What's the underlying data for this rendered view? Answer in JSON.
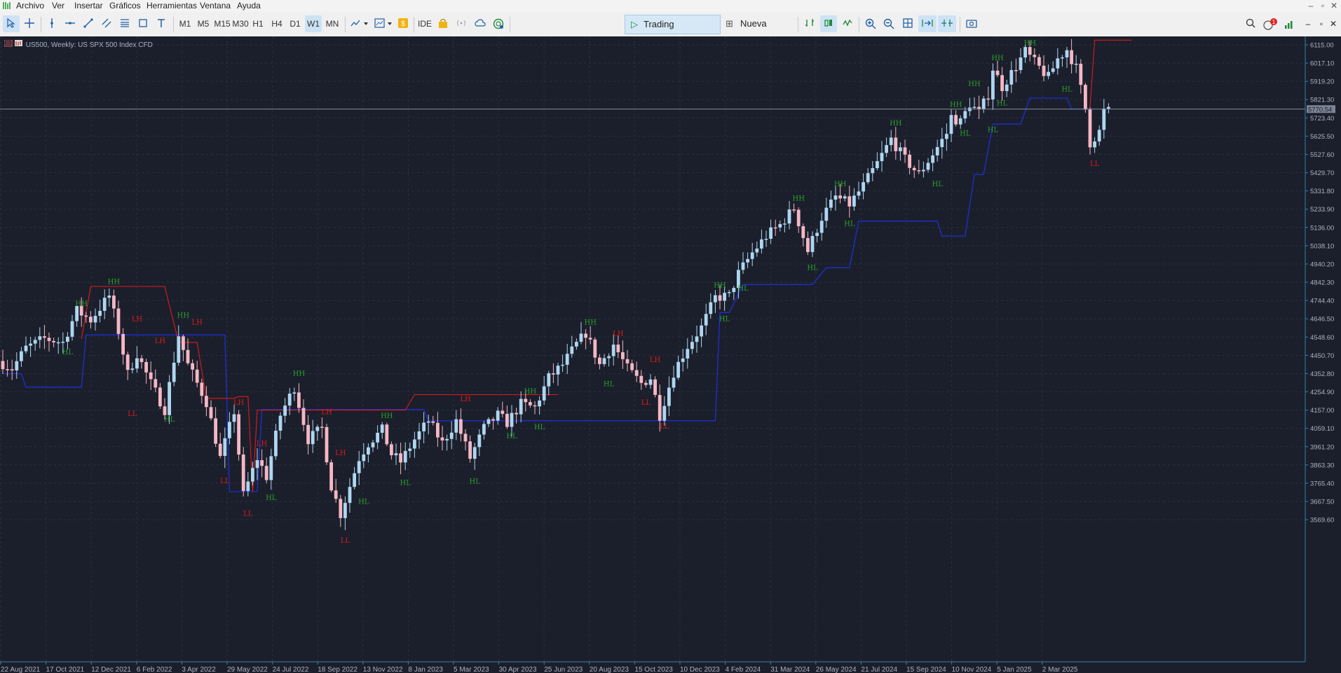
{
  "menu": {
    "items": [
      "Archivo",
      "Ver",
      "Insertar",
      "Gráficos",
      "Herramientas",
      "Ventana",
      "Ayuda"
    ]
  },
  "toolbar": {
    "timeframes": [
      "M1",
      "M5",
      "M15",
      "M30",
      "H1",
      "H4",
      "D1",
      "W1",
      "MN"
    ],
    "active_timeframe": "W1",
    "ide_label": "IDE",
    "algo_label": "Trading algorítmico",
    "order_label": "Nueva Orden",
    "notification_count": "1"
  },
  "chart": {
    "title": "US500, Weekly:  US SPX 500 Index CFD",
    "current_price": "5770.54",
    "price_axis": [
      "6115.00",
      "6017.10",
      "5919.20",
      "5821.30",
      "5723.40",
      "5625.50",
      "5527.60",
      "5429.70",
      "5331.80",
      "5233.90",
      "5136.00",
      "5038.10",
      "4940.20",
      "4842.30",
      "4744.40",
      "4646.50",
      "4548.60",
      "4450.70",
      "4352.80",
      "4254.90",
      "4157.00",
      "4059.10",
      "3961.20",
      "3863.30",
      "3765.40",
      "3667.50",
      "3569.60"
    ],
    "time_axis": [
      "22 Aug 2021",
      "17 Oct 2021",
      "12 Dec 2021",
      "6 Feb 2022",
      "3 Apr 2022",
      "29 May 2022",
      "24 Jul 2022",
      "18 Sep 2022",
      "13 Nov 2022",
      "8 Jan 2023",
      "5 Mar 2023",
      "30 Apr 2023",
      "25 Jun 2023",
      "20 Aug 2023",
      "15 Oct 2023",
      "10 Dec 2023",
      "4 Feb 2024",
      "31 Mar 2024",
      "26 May 2024",
      "21 Jul 2024",
      "15 Sep 2024",
      "10 Nov 2024",
      "5 Jan 2025",
      "2 Mar 2025"
    ],
    "colors": {
      "background": "#1b1f2b",
      "bull_candle": "#aed6f1",
      "bear_candle": "#f5b7c5",
      "support_line": "#1f2fd0",
      "resistance_line": "#e01a1a",
      "higher_label": "#2aa12a",
      "lower_label": "#e01a1a",
      "current_price_line": "#8a8f9c"
    },
    "swing_labels": [
      {
        "text": "HH",
        "price": 4700,
        "week": 17,
        "side": "up"
      },
      {
        "text": "HL",
        "price": 4500,
        "week": 14,
        "side": "down"
      },
      {
        "text": "HH",
        "price": 4818,
        "week": 24,
        "side": "up"
      },
      {
        "text": "LH",
        "price": 4620,
        "week": 29,
        "side": "up"
      },
      {
        "text": "LL",
        "price": 4170,
        "week": 28,
        "side": "down"
      },
      {
        "text": "LH",
        "price": 4500,
        "week": 34,
        "side": "up"
      },
      {
        "text": "HL",
        "price": 4140,
        "week": 36,
        "side": "down"
      },
      {
        "text": "HH",
        "price": 4637,
        "week": 39,
        "side": "up"
      },
      {
        "text": "LH",
        "price": 4600,
        "week": 42,
        "side": "up"
      },
      {
        "text": "LL",
        "price": 3810,
        "week": 48,
        "side": "down"
      },
      {
        "text": "LH",
        "price": 4170,
        "week": 51,
        "side": "up"
      },
      {
        "text": "LL",
        "price": 3636,
        "week": 53,
        "side": "down"
      },
      {
        "text": "LH",
        "price": 3950,
        "week": 56,
        "side": "up"
      },
      {
        "text": "HL",
        "price": 3720,
        "week": 58,
        "side": "down"
      },
      {
        "text": "HH",
        "price": 4327,
        "week": 64,
        "side": "up"
      },
      {
        "text": "LH",
        "price": 4120,
        "week": 70,
        "side": "up"
      },
      {
        "text": "LL",
        "price": 3491,
        "week": 74,
        "side": "down"
      },
      {
        "text": "LH",
        "price": 3900,
        "week": 73,
        "side": "up"
      },
      {
        "text": "HL",
        "price": 3700,
        "week": 78,
        "side": "down"
      },
      {
        "text": "HH",
        "price": 4100,
        "week": 83,
        "side": "up"
      },
      {
        "text": "HL",
        "price": 3800,
        "week": 87,
        "side": "down"
      },
      {
        "text": "LH",
        "price": 4190,
        "week": 100,
        "side": "up"
      },
      {
        "text": "HL",
        "price": 3808,
        "week": 102,
        "side": "down"
      },
      {
        "text": "HL",
        "price": 4050,
        "week": 110,
        "side": "down"
      },
      {
        "text": "HH",
        "price": 4230,
        "week": 114,
        "side": "up"
      },
      {
        "text": "HL",
        "price": 4100,
        "week": 116,
        "side": "down"
      },
      {
        "text": "HH",
        "price": 4600,
        "week": 127,
        "side": "up"
      },
      {
        "text": "HL",
        "price": 4330,
        "week": 131,
        "side": "down"
      },
      {
        "text": "LH",
        "price": 4540,
        "week": 133,
        "side": "up"
      },
      {
        "text": "LL",
        "price": 4230,
        "week": 139,
        "side": "down"
      },
      {
        "text": "LH",
        "price": 4400,
        "week": 141,
        "side": "up"
      },
      {
        "text": "LL",
        "price": 4103,
        "week": 143,
        "side": "down"
      },
      {
        "text": "HH",
        "price": 4800,
        "week": 155,
        "side": "up"
      },
      {
        "text": "HL",
        "price": 4680,
        "week": 156,
        "side": "down"
      },
      {
        "text": "HL",
        "price": 4842,
        "week": 160,
        "side": "down"
      },
      {
        "text": "HH",
        "price": 5264,
        "week": 172,
        "side": "up"
      },
      {
        "text": "HL",
        "price": 4953,
        "week": 175,
        "side": "down"
      },
      {
        "text": "HH",
        "price": 5341,
        "week": 181,
        "side": "up"
      },
      {
        "text": "HL",
        "price": 5190,
        "week": 183,
        "side": "down"
      },
      {
        "text": "HH",
        "price": 5669,
        "week": 193,
        "side": "up"
      },
      {
        "text": "HL",
        "price": 5402,
        "week": 202,
        "side": "down"
      },
      {
        "text": "HH",
        "price": 5767,
        "week": 206,
        "side": "up"
      },
      {
        "text": "HL",
        "price": 5674,
        "week": 208,
        "side": "down"
      },
      {
        "text": "HH",
        "price": 5878,
        "week": 210,
        "side": "up"
      },
      {
        "text": "HL",
        "price": 5692,
        "week": 214,
        "side": "down"
      },
      {
        "text": "HH",
        "price": 6017,
        "week": 215,
        "side": "up"
      },
      {
        "text": "HL",
        "price": 5835,
        "week": 216,
        "side": "down"
      },
      {
        "text": "HH",
        "price": 6099,
        "week": 222,
        "side": "up"
      },
      {
        "text": "HL",
        "price": 5910,
        "week": 230,
        "side": "down"
      },
      {
        "text": "LL",
        "price": 5510,
        "week": 236,
        "side": "down"
      }
    ]
  }
}
